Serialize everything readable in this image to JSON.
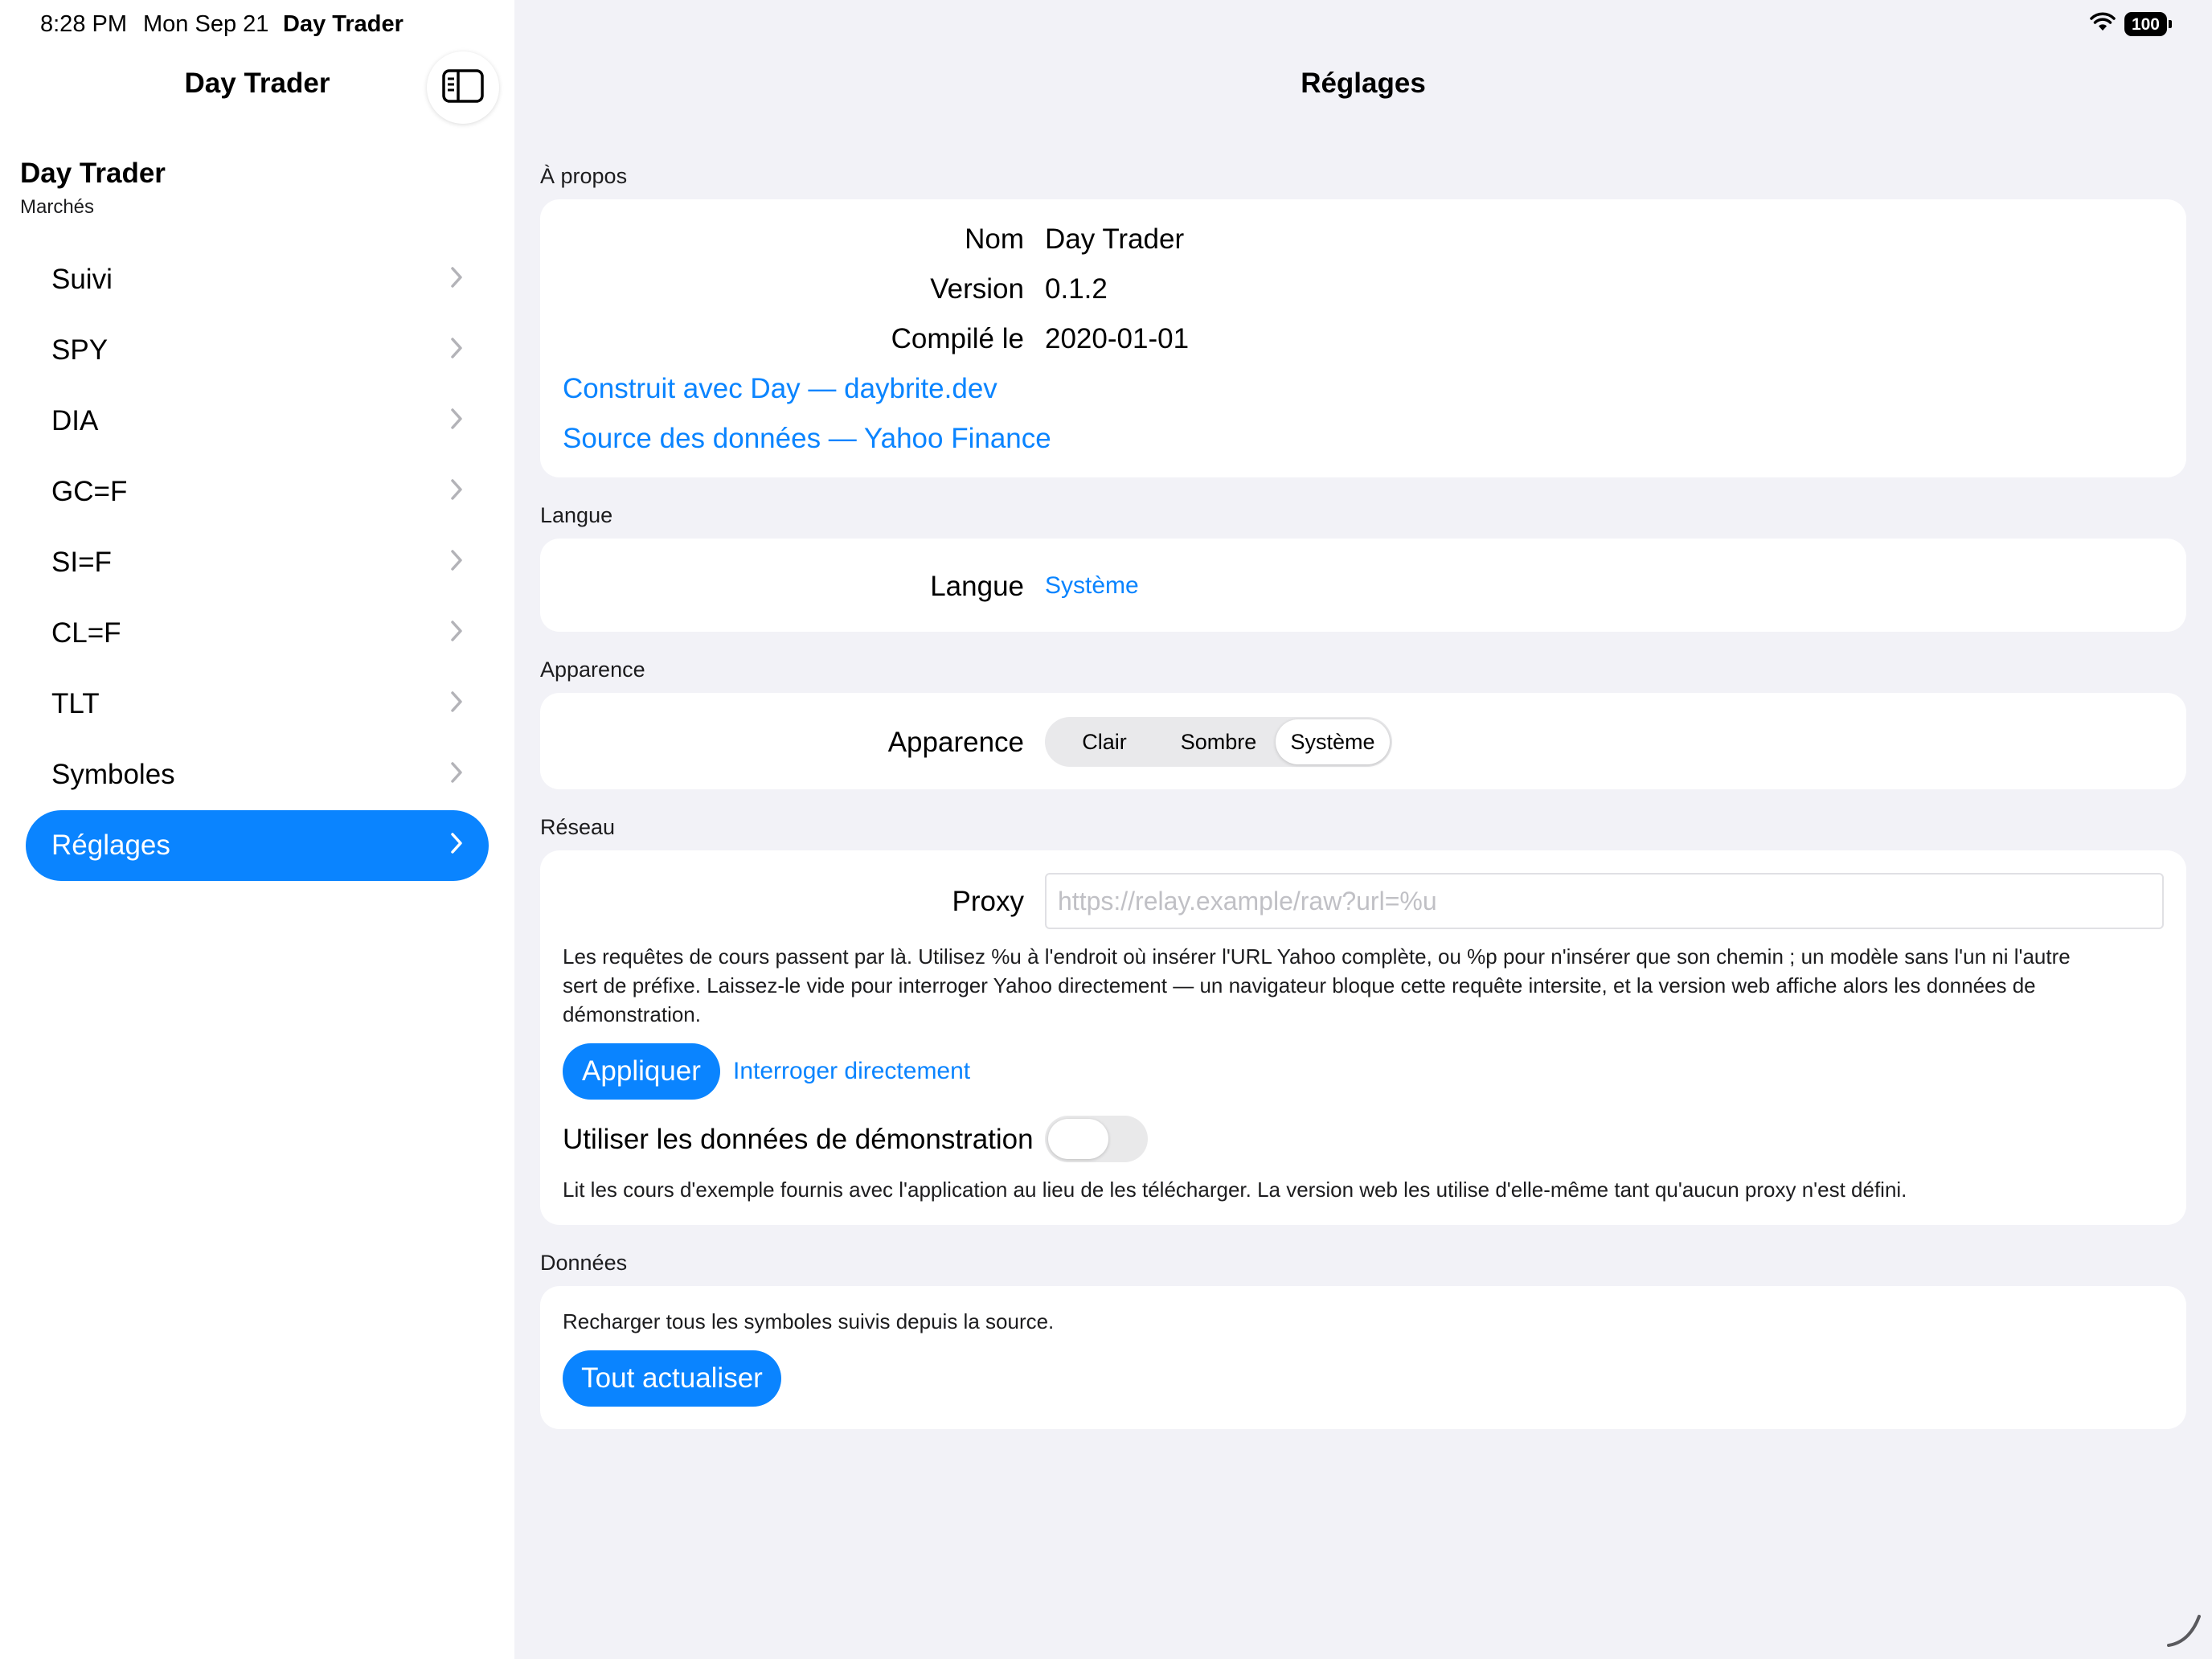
{
  "status_bar": {
    "time": "8:28 PM",
    "date": "Mon Sep 21",
    "app": "Day Trader",
    "battery": "100"
  },
  "sidebar": {
    "title": "Day Trader",
    "section_title": "Day Trader",
    "section_subtitle": "Marchés",
    "items": [
      {
        "label": "Suivi"
      },
      {
        "label": "SPY"
      },
      {
        "label": "DIA"
      },
      {
        "label": "GC=F"
      },
      {
        "label": "SI=F"
      },
      {
        "label": "CL=F"
      },
      {
        "label": "TLT"
      },
      {
        "label": "Symboles"
      },
      {
        "label": "Réglages"
      }
    ],
    "active_index": 8
  },
  "main": {
    "title": "Réglages",
    "about": {
      "label": "À propos",
      "name_label": "Nom",
      "name_value": "Day Trader",
      "version_label": "Version",
      "version_value": "0.1.2",
      "compiled_label": "Compilé le",
      "compiled_value": "2020-01-01",
      "built_with_link": "Construit avec Day — daybrite.dev",
      "source_link": "Source des données — Yahoo Finance"
    },
    "language": {
      "label": "Langue",
      "row_label": "Langue",
      "value": "Système"
    },
    "appearance": {
      "label": "Apparence",
      "row_label": "Apparence",
      "options": [
        "Clair",
        "Sombre",
        "Système"
      ],
      "selected": "Système"
    },
    "network": {
      "label": "Réseau",
      "proxy_label": "Proxy",
      "proxy_value": "",
      "proxy_placeholder": "https://relay.example/raw?url=%u",
      "help_line1": "Les requêtes de cours passent par là. Utilisez %u à l'endroit où insérer l'URL Yahoo complète, ou %p pour n'insérer que son chemin ; un modèle sans l'un ni l'autre",
      "help_line2": "sert de préfixe. Laissez-le vide pour interroger Yahoo directement — un navigateur bloque cette requête intersite, et la version web affiche alors les données de",
      "help_line3": "démonstration.",
      "apply_button": "Appliquer",
      "direct_link": "Interroger directement",
      "demo_label": "Utiliser les données de démonstration",
      "demo_enabled": false,
      "demo_help": "Lit les cours d'exemple fournis avec l'application au lieu de les télécharger. La version web les utilise d'elle-même tant qu'aucun proxy n'est défini."
    },
    "data": {
      "label": "Données",
      "description": "Recharger tous les symboles suivis depuis la source.",
      "refresh_button": "Tout actualiser"
    }
  }
}
